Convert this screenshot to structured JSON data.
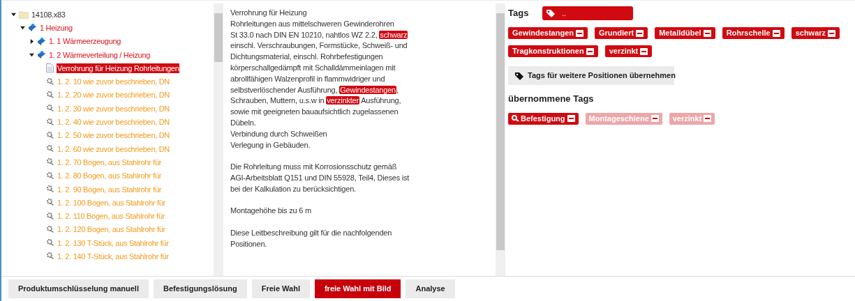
{
  "tree": [
    {
      "label": "14108.x83",
      "kind": "root",
      "expanded": true,
      "selected": false,
      "children": [
        {
          "label": "1 Heizung",
          "kind": "group",
          "expanded": true,
          "selected": false,
          "children": [
            {
              "label": "1. 1 Wärmeerzeugung",
              "kind": "group",
              "expanded": false,
              "selected": false
            },
            {
              "label": "1. 2 Wärmeverteilung / Heizung",
              "kind": "group",
              "expanded": true,
              "selected": false,
              "children": [
                {
                  "label": "Verrohrung für Heizung Rohrleitungen",
                  "kind": "document",
                  "selected": true
                },
                {
                  "label": "1. 2. 10 wie zuvor beschrieben, DN",
                  "kind": "position",
                  "selected": false
                },
                {
                  "label": "1. 2. 20 wie zuvor beschrieben, DN",
                  "kind": "position",
                  "selected": false
                },
                {
                  "label": "1. 2. 30 wie zuvor beschrieben, DN",
                  "kind": "position",
                  "selected": false
                },
                {
                  "label": "1. 2. 40 wie zuvor beschrieben, DN",
                  "kind": "position",
                  "selected": false
                },
                {
                  "label": "1. 2. 50 wie zuvor beschrieben, DN",
                  "kind": "position",
                  "selected": false
                },
                {
                  "label": "1. 2. 60 wie zuvor beschrieben, DN",
                  "kind": "position",
                  "selected": false
                },
                {
                  "label": "1. 2. 70 Bogen, aus Stahlrohr für",
                  "kind": "position",
                  "selected": false
                },
                {
                  "label": "1. 2. 80 Bogen, aus Stahlrohr für",
                  "kind": "position",
                  "selected": false
                },
                {
                  "label": "1. 2. 90 Bogen, aus Stahlrohr für",
                  "kind": "position",
                  "selected": false
                },
                {
                  "label": "1. 2. 100 Bogen, aus Stahlrohr für",
                  "kind": "position",
                  "selected": false
                },
                {
                  "label": "1. 2. 110 Bogen, aus Stahlrohr für",
                  "kind": "position",
                  "selected": false
                },
                {
                  "label": "1. 2. 120 Bogen, aus Stahlrohr für",
                  "kind": "position",
                  "selected": false
                },
                {
                  "label": "1. 2. 130 T-Stück, aus Stahlrohr für",
                  "kind": "position",
                  "selected": false
                },
                {
                  "label": "1. 2. 140 T-Stück, aus Stahlrohr für",
                  "kind": "position",
                  "selected": false
                }
              ]
            }
          ]
        }
      ]
    }
  ],
  "description": [
    [
      [
        {
          "text": "Verrohrung für Heizung",
          "highlighted": false
        }
      ],
      [
        {
          "text": "Rohrleitungen aus mittelschweren Gewinderohren",
          "highlighted": false
        }
      ],
      [
        {
          "text": "St 33.0 nach DIN EN 10210, nahtlos WZ 2.2, ",
          "highlighted": false
        },
        {
          "text": "schwarz",
          "highlighted": true
        }
      ],
      [
        {
          "text": "einschl. Verschraubungen, Formstücke, Schweiß- und",
          "highlighted": false
        }
      ],
      [
        {
          "text": "Dichtungsmaterial, einschl. Rohrbefestigungen",
          "highlighted": false
        }
      ],
      [
        {
          "text": "körperschallgedämpft mit Schalldämmeinlagen mit",
          "highlighted": false
        }
      ],
      [
        {
          "text": "abrollfähigen Walzenprofil in flammwidriger und",
          "highlighted": false
        }
      ],
      [
        {
          "text": "selbstverlöschender Ausführung, ",
          "highlighted": false
        },
        {
          "text": "Gewindestangen",
          "highlighted": true
        },
        {
          "text": ",",
          "highlighted": false
        }
      ],
      [
        {
          "text": "Schrauben, Muttern, u.s.w in ",
          "highlighted": false
        },
        {
          "text": "verzinkter",
          "highlighted": true
        },
        {
          "text": " Ausführung,",
          "highlighted": false
        }
      ],
      [
        {
          "text": "sowie mit geeigneten bauaufsichtlich zugelassenen",
          "highlighted": false
        }
      ],
      [
        {
          "text": "Dübeln.",
          "highlighted": false
        }
      ],
      [
        {
          "text": "Verbindung durch Schweißen",
          "highlighted": false
        }
      ],
      [
        {
          "text": "Verlegung in Gebäuden.",
          "highlighted": false
        }
      ]
    ],
    [
      [
        {
          "text": "Die Rohrleitung muss mit Korrosionsschutz gemäß",
          "highlighted": false
        }
      ],
      [
        {
          "text": "AGI-Arbeitsblatt Q151 und DIN 55928, Teil4, Dieses ist",
          "highlighted": false
        }
      ],
      [
        {
          "text": "bei der Kalkulation zu berücksichtigen.",
          "highlighted": false
        }
      ]
    ],
    [
      [
        {
          "text": "Montagehöhe bis zu 6 m",
          "highlighted": false
        }
      ]
    ],
    [
      [
        {
          "text": "Diese Leitbeschreibung gilt für die nachfolgenden",
          "highlighted": false
        }
      ],
      [
        {
          "text": "Positionen.",
          "highlighted": false
        }
      ]
    ]
  ],
  "tags": {
    "title": "Tags",
    "input_value": "..",
    "items": [
      "Gewindestangen",
      "Grundiert",
      "Metalldübel",
      "Rohrschelle",
      "schwarz",
      "Tragkonstruktionen",
      "verzinkt"
    ],
    "apply_button": "Tags für weitere Positionen übernehmen",
    "adopted_title": "übernommene Tags",
    "adopted": [
      {
        "label": "Befestigung",
        "kind": "pinned",
        "disabled": false
      },
      {
        "label": "Montageschiene",
        "kind": "plain",
        "disabled": true
      },
      {
        "label": "verzinkt",
        "kind": "plain",
        "disabled": true
      }
    ]
  },
  "bottom_tabs": [
    {
      "label": "Produktumschlüsselung manuell",
      "selected": false
    },
    {
      "label": "Befestigungslösung",
      "selected": false
    },
    {
      "label": "Freie Wahl",
      "selected": false
    },
    {
      "label": "freie Wahl mit Bild",
      "selected": true
    },
    {
      "label": "Analyse",
      "selected": false
    }
  ]
}
